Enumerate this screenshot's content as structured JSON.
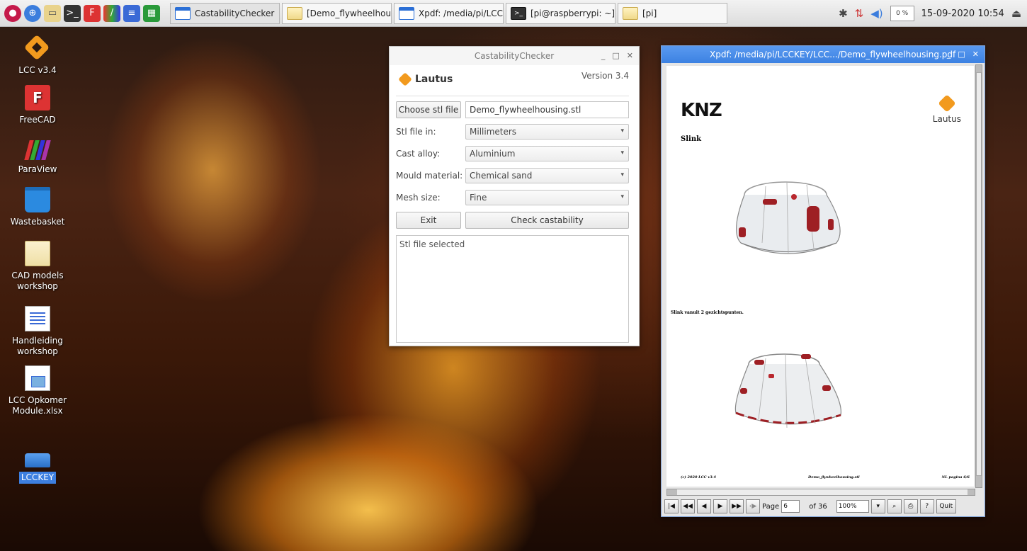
{
  "taskbar": {
    "tasks": [
      {
        "label": "CastabilityChecker",
        "icon": "window-icon"
      },
      {
        "label": "[Demo_flywheelhous...",
        "icon": "folder-icon"
      },
      {
        "label": "Xpdf: /media/pi/LCC...",
        "icon": "window-icon"
      },
      {
        "label": "[pi@raspberrypi: ~]",
        "icon": "terminal-icon"
      },
      {
        "label": "[pi]",
        "icon": "folder-icon"
      }
    ],
    "cpu": "0 %",
    "clock": "15-09-2020 10:54"
  },
  "desktop": {
    "icons": [
      {
        "label": "LCC v3.4",
        "icon": "lcc-icon"
      },
      {
        "label": "FreeCAD",
        "icon": "freecad-icon"
      },
      {
        "label": "ParaView",
        "icon": "paraview-icon"
      },
      {
        "label": "Wastebasket",
        "icon": "trash-icon"
      },
      {
        "label": "CAD models workshop",
        "icon": "folder-icon"
      },
      {
        "label": "Handleiding workshop",
        "icon": "document-icon"
      },
      {
        "label": "LCC Opkomer Module.xlsx",
        "icon": "spreadsheet-icon"
      },
      {
        "label": "LCCKEY",
        "icon": "drive-icon"
      }
    ]
  },
  "castability": {
    "title": "CastabilityChecker",
    "brand": "Lautus",
    "version": "Version 3.4",
    "choose_button": "Choose stl file",
    "file_name": "Demo_flywheelhousing.stl",
    "fields": [
      {
        "label": "Stl file in:",
        "value": "Millimeters"
      },
      {
        "label": "Cast alloy:",
        "value": "Aluminium"
      },
      {
        "label": "Mould material:",
        "value": "Chemical sand"
      },
      {
        "label": "Mesh size:",
        "value": "Fine"
      }
    ],
    "exit_button": "Exit",
    "check_button": "Check castability",
    "output": "Stl file selected"
  },
  "xpdf": {
    "title": "Xpdf: /media/pi/LCCKEY/LCC.../Demo_flywheelhousing.pdf",
    "page": {
      "logo_text": "KNZ",
      "brand": "Lautus",
      "heading": "Slink",
      "caption": "Slink vanuit 2 gezichtspunten.",
      "footer_left": "(c) 2020 LCC v3.4",
      "footer_center": "Demo_flywheelhousing.stl",
      "footer_right": "NL pagina 6/6"
    },
    "toolbar": {
      "page_label": "Page",
      "page_value": "6",
      "of_label": "of 36",
      "zoom": "100%",
      "quit": "Quit"
    }
  }
}
